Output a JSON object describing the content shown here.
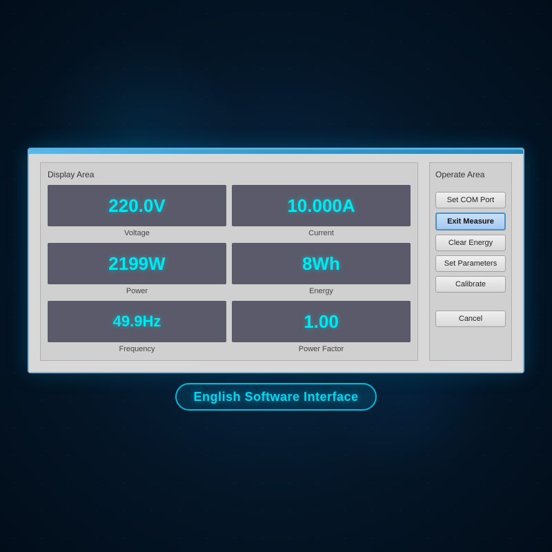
{
  "background": {
    "color": "#041525"
  },
  "dialog": {
    "display_area_label": "Display Area",
    "operate_area_label": "Operate Area",
    "metrics": [
      {
        "value": "220.0V",
        "label": "Voltage",
        "id": "voltage"
      },
      {
        "value": "10.000A",
        "label": "Current",
        "id": "current"
      },
      {
        "value": "2199W",
        "label": "Power",
        "id": "power"
      },
      {
        "value": "8Wh",
        "label": "Energy",
        "id": "energy"
      },
      {
        "value": "49.9Hz",
        "label": "Frequency",
        "id": "frequency"
      },
      {
        "value": "1.00",
        "label": "Power Factor",
        "id": "power-factor"
      }
    ],
    "buttons": [
      {
        "label": "Set COM Port",
        "id": "set-com-port",
        "active": false
      },
      {
        "label": "Exit Measure",
        "id": "exit-measure",
        "active": true
      },
      {
        "label": "Clear Energy",
        "id": "clear-energy",
        "active": false
      },
      {
        "label": "Set Parameters",
        "id": "set-parameters",
        "active": false
      },
      {
        "label": "Calibrate",
        "id": "calibrate",
        "active": false
      },
      {
        "label": "Cancel",
        "id": "cancel",
        "active": false,
        "is_cancel": true
      }
    ]
  },
  "footer": {
    "label": "English Software Interface"
  }
}
